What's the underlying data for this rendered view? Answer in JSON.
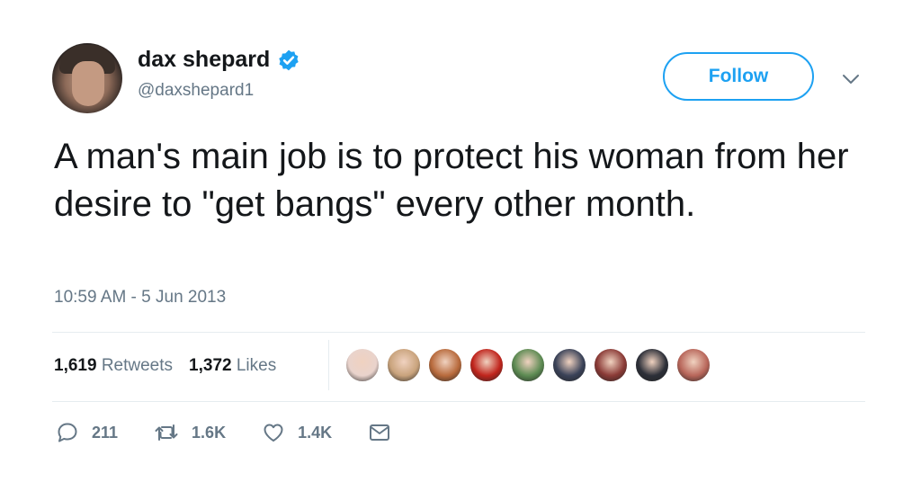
{
  "author": {
    "display_name": "dax shepard",
    "handle": "@daxshepard1",
    "verified": true,
    "avatar_icon": "profile-photo"
  },
  "follow_label": "Follow",
  "tweet": {
    "text": "A man's main job is to protect his woman from her desire to \"get bangs\" every other month.",
    "timestamp": "10:59 AM - 5 Jun 2013"
  },
  "stats": {
    "retweets_count": "1,619",
    "retweets_label": "Retweets",
    "likes_count": "1,372",
    "likes_label": "Likes"
  },
  "liker_avatars": [
    {
      "name": "liker-avatar-1",
      "color": "#e9d3cc"
    },
    {
      "name": "liker-avatar-2",
      "color": "#c9a37c"
    },
    {
      "name": "liker-avatar-3",
      "color": "#b86a3c"
    },
    {
      "name": "liker-avatar-4",
      "color": "#c0241c"
    },
    {
      "name": "liker-avatar-5",
      "color": "#5c8a52"
    },
    {
      "name": "liker-avatar-6",
      "color": "#3a4258"
    },
    {
      "name": "liker-avatar-7",
      "color": "#8a3a36"
    },
    {
      "name": "liker-avatar-8",
      "color": "#2c2f38"
    },
    {
      "name": "liker-avatar-9",
      "color": "#b8665a"
    }
  ],
  "actions": {
    "reply_count": "211",
    "retweet_count": "1.6K",
    "like_count": "1.4K"
  },
  "colors": {
    "accent": "#1da1f2",
    "text": "#14171a",
    "muted": "#657786",
    "divider": "#e6ecf0"
  }
}
